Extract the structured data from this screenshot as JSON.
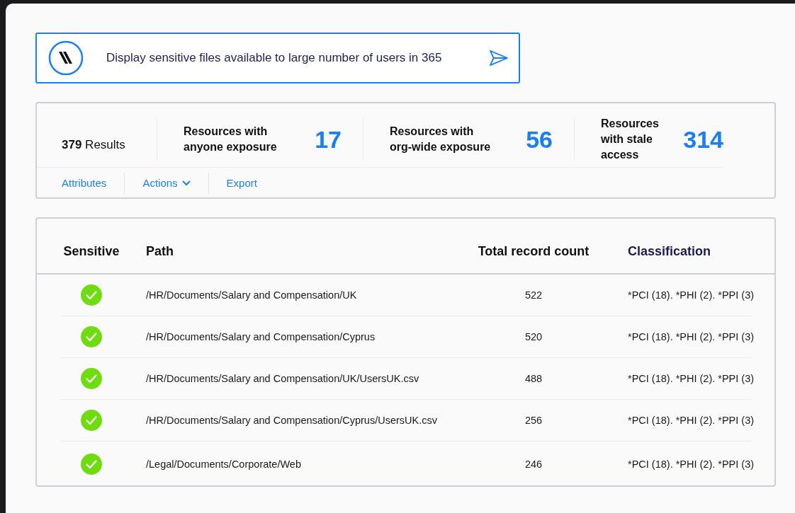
{
  "query": {
    "text": "Display sensitive files available to large number of users in 365"
  },
  "summary": {
    "results": "**379** Results",
    "stats": [
      {
        "label": "Resources with anyone exposure",
        "value": "17"
      },
      {
        "label": "Resources with org-wide exposure",
        "value": "56"
      },
      {
        "label": "Resources with stale access",
        "value": "314"
      }
    ],
    "actions": [
      {
        "label": "Attributes",
        "kind": "link"
      },
      {
        "label": "Actions",
        "kind": "dropdown"
      },
      {
        "label": "Export",
        "kind": "link"
      }
    ]
  },
  "table": {
    "columns": [
      "Sensitive",
      "Path",
      "Total record count",
      "Classification"
    ],
    "rows": [
      {
        "sensitive": true,
        "path": "/HR/Documents/Salary and Compensation/UK",
        "count": "522",
        "classification": "*PCI (18). *PHI (2). *PPI (3)"
      },
      {
        "sensitive": true,
        "path": "/HR/Documents/Salary and Compensation/Cyprus",
        "count": "520",
        "classification": "*PCI (18). *PHI (2). *PPI (3)"
      },
      {
        "sensitive": true,
        "path": "/HR/Documents/Salary and Compensation/UK/UsersUK.csv",
        "count": "488",
        "classification": "*PCI (18). *PHI (2). *PPI (3)"
      },
      {
        "sensitive": true,
        "path": "/HR/Documents/Salary and Compensation/Cyprus/UsersUK.csv",
        "count": "256",
        "classification": "*PCI (18). *PHI (2). *PPI (3)"
      },
      {
        "sensitive": true,
        "path": "/Legal/Documents/Corporate/Web",
        "count": "246",
        "classification": "*PCI (18). *PHI (2). *PPI (3)"
      }
    ]
  }
}
